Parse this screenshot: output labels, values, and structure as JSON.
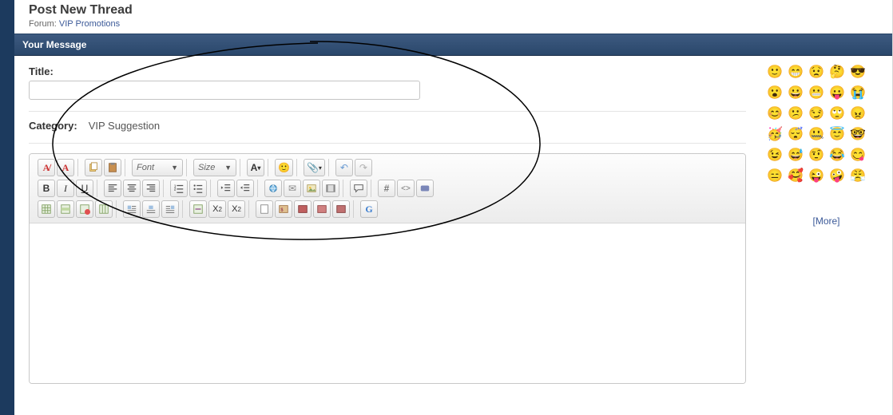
{
  "header": {
    "title": "Post New Thread",
    "forum_prefix": "Forum:",
    "forum_name": "VIP Promotions"
  },
  "section": {
    "message_bar": "Your Message"
  },
  "form": {
    "title_label": "Title:",
    "title_value": "",
    "category_label": "Category:",
    "category_value": "VIP Suggestion"
  },
  "toolbar": {
    "font_label": "Font",
    "size_label": "Size"
  },
  "smilies": {
    "more": "[More]",
    "list": [
      "🙂",
      "😁",
      "😟",
      "🤔",
      "😎",
      "😮",
      "😀",
      "😬",
      "😛",
      "😭",
      "😊",
      "😕",
      "😏",
      "🙄",
      "😠",
      "🥳",
      "😴",
      "🤐",
      "😇",
      "🤓",
      "😉",
      "😅",
      "🤨",
      "😂",
      "😋",
      "😑",
      "🥰",
      "😜",
      "🤪",
      "😤"
    ]
  }
}
